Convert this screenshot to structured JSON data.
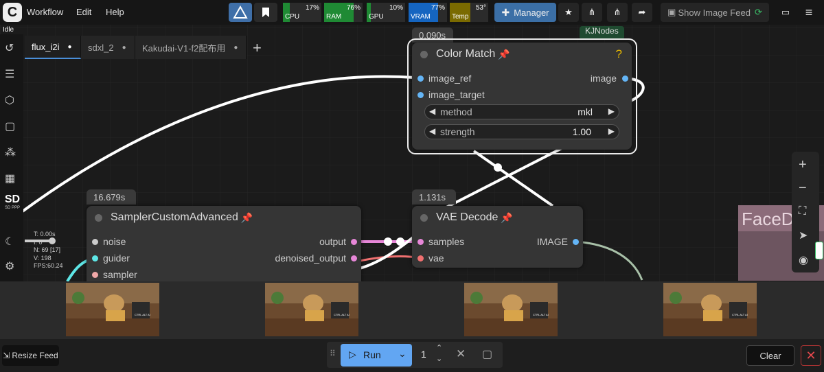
{
  "menu": {
    "workflow": "Workflow",
    "edit": "Edit",
    "help": "Help"
  },
  "status": {
    "idle": "Idle"
  },
  "meters": {
    "cpu": {
      "label": "CPU",
      "value": "17%",
      "fraction": 0.17,
      "color": "#1f8a34"
    },
    "ram": {
      "label": "RAM",
      "value": "76%",
      "fraction": 0.76,
      "color": "#1f8a34"
    },
    "gpu": {
      "label": "GPU",
      "value": "10%",
      "fraction": 0.1,
      "color": "#1f8a34"
    },
    "vram": {
      "label": "VRAM",
      "value": "77%",
      "fraction": 0.77,
      "color": "#1565c0"
    },
    "temp": {
      "label": "Temp",
      "value": "53°",
      "fraction": 0.53,
      "color": "#7a6a00"
    }
  },
  "toolbar": {
    "manager": "Manager",
    "show_image_feed": "Show Image Feed"
  },
  "sidebar": {
    "sd_label": "SD PPP"
  },
  "tabs": [
    {
      "label": "flux_i2i",
      "active": true
    },
    {
      "label": "sdxl_2",
      "active": false
    },
    {
      "label": "Kakudai-V1-f2配布用",
      "active": false
    }
  ],
  "nodes": {
    "color_match": {
      "timing": "0.090s",
      "title": "Color Match",
      "help": "?",
      "inputs": [
        "image_ref",
        "image_target"
      ],
      "output": "image",
      "widgets": [
        {
          "label": "method",
          "value": "mkl"
        },
        {
          "label": "strength",
          "value": "1.00"
        }
      ],
      "partial_badge": "KJNodes"
    },
    "sampler": {
      "timing": "16.679s",
      "title": "SamplerCustomAdvanced",
      "inputs": [
        "noise",
        "guider",
        "sampler"
      ],
      "outputs": [
        "output",
        "denoised_output"
      ]
    },
    "vae_decode": {
      "timing": "1.131s",
      "title": "VAE Decode",
      "inputs": [
        "samples",
        "vae"
      ],
      "output": "IMAGE"
    },
    "face_partial": {
      "title": "FaceD"
    }
  },
  "stats": {
    "t": "T: 0.00s",
    "i": "I: 0",
    "n": "N: 69 [17]",
    "v": "V: 198",
    "fps": "FPS:60.24"
  },
  "feed": {
    "thumb_label": "CTRL ALT AI"
  },
  "bottom": {
    "resize_feed": "Resize Feed",
    "run": "Run",
    "count": "1",
    "clear": "Clear"
  },
  "colors": {
    "accent": "#62a6f2",
    "link_pink": "#e787d8",
    "link_red": "#f07070",
    "link_teal": "#5ee6e6",
    "link_white": "#ffffff"
  }
}
